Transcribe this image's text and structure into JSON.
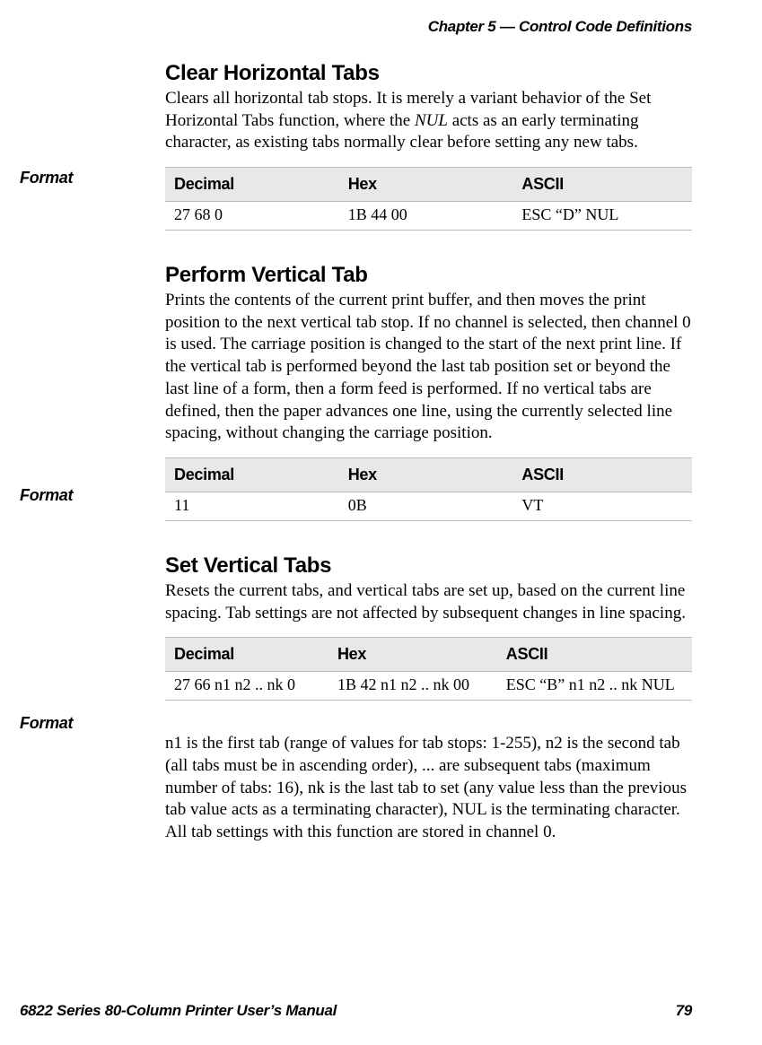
{
  "header": {
    "chapter": "Chapter 5 — Control Code Definitions"
  },
  "sections": {
    "s1": {
      "heading": "Clear Horizontal Tabs",
      "body_pre": "Clears all horizontal tab stops. It is merely a variant behavior of the Set Horizontal Tabs function, where the ",
      "body_italic": "NUL",
      "body_post": " acts as an early terminating character, as existing tabs normally clear before setting any new tabs.",
      "format_label": "Format",
      "table": {
        "headers": {
          "c0": "Decimal",
          "c1": "Hex",
          "c2": "ASCII"
        },
        "row": {
          "c0": "27 68 0",
          "c1": "1B 44 00",
          "c2": "ESC “D” NUL"
        }
      }
    },
    "s2": {
      "heading": "Perform Vertical Tab",
      "body": "Prints the contents of the current print buffer, and then moves the print position to the next vertical tab stop. If no channel is selected, then channel 0 is used. The carriage position is changed to the start of the next print line. If the vertical tab is performed beyond the last tab position set or beyond the last line of a form, then a form feed is performed. If no vertical tabs are defined, then the paper advances one line, using the currently selected line spacing, without changing the carriage position.",
      "format_label": "Format",
      "table": {
        "headers": {
          "c0": "Decimal",
          "c1": "Hex",
          "c2": "ASCII"
        },
        "row": {
          "c0": "11",
          "c1": "0B",
          "c2": "VT"
        }
      }
    },
    "s3": {
      "heading": "Set Vertical Tabs",
      "body": "Resets the current tabs, and vertical tabs are set up, based on the current line spacing. Tab settings are not affected by subsequent changes in line spacing.",
      "format_label": "Format",
      "table": {
        "headers": {
          "c0": "Decimal",
          "c1": "Hex",
          "c2": "ASCII"
        },
        "row": {
          "c0": "27 66 n1 n2 .. nk 0",
          "c1": "1B 42 n1 n2 .. nk 00",
          "c2": "ESC “B” n1 n2 .. nk NUL"
        }
      },
      "note": "n1 is the first tab (range of values for tab stops: 1-255), n2 is the second tab (all tabs must be in ascending order), ... are subsequent tabs (maximum number of tabs: 16), nk is the last tab to set (any value less than the previous tab value acts as a terminating character), NUL is the terminating character. All tab settings with this function are stored in channel 0."
    }
  },
  "footer": {
    "left": "6822 Series 80-Column Printer User’s Manual",
    "right": "79"
  }
}
